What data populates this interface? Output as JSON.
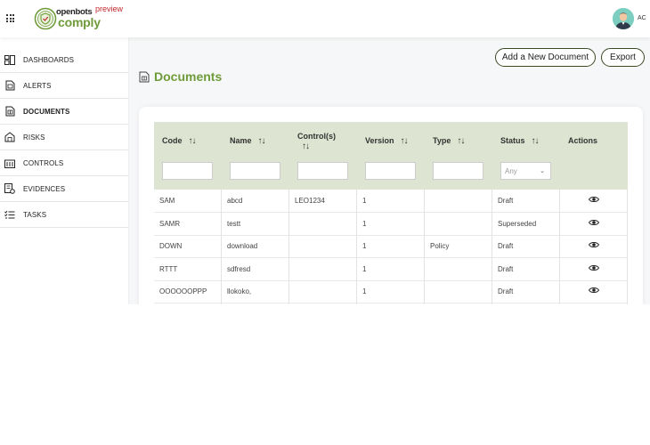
{
  "header": {
    "brand_top": "openbots",
    "brand_bottom": "comply",
    "preview_label": "preview",
    "user_initials": "AC"
  },
  "sidebar": {
    "items": [
      {
        "label": "DASHBOARDS",
        "icon": "dashboard-icon"
      },
      {
        "label": "ALERTS",
        "icon": "alert-icon"
      },
      {
        "label": "DOCUMENTS",
        "icon": "documents-icon",
        "active": true
      },
      {
        "label": "RISKS",
        "icon": "risks-icon"
      },
      {
        "label": "CONTROLS",
        "icon": "controls-icon"
      },
      {
        "label": "EVIDENCES",
        "icon": "evidences-icon"
      },
      {
        "label": "TASKS",
        "icon": "tasks-icon"
      }
    ]
  },
  "toolbar": {
    "add_label": "Add a New Document",
    "export_label": "Export"
  },
  "page": {
    "title": "Documents"
  },
  "table": {
    "columns": [
      {
        "label": "Code",
        "sort_icon": "↑↓"
      },
      {
        "label": "Name",
        "sort_icon": "↑↓"
      },
      {
        "label": "Control(s)",
        "sort_icon": "↑↓"
      },
      {
        "label": "Version",
        "sort_icon": "↑↓"
      },
      {
        "label": "Type",
        "sort_icon": "↑↓"
      },
      {
        "label": "Status",
        "sort_icon": "↑↓"
      },
      {
        "label": "Actions"
      }
    ],
    "status_filter_value": "Any",
    "rows": [
      {
        "code": "SAM",
        "name": "abcd",
        "controls": "LEO1234",
        "version": "1",
        "type": "",
        "status": "Draft"
      },
      {
        "code": "SAMR",
        "name": "testt",
        "controls": "",
        "version": "1",
        "type": "",
        "status": "Superseded"
      },
      {
        "code": "DOWN",
        "name": "download",
        "controls": "",
        "version": "1",
        "type": "Policy",
        "status": "Draft"
      },
      {
        "code": "RTTT",
        "name": "sdfresd",
        "controls": "",
        "version": "1",
        "type": "",
        "status": "Draft"
      },
      {
        "code": "OOOOOOPPP",
        "name": "llokoko,",
        "controls": "",
        "version": "1",
        "type": "",
        "status": "Draft"
      }
    ]
  },
  "colors": {
    "brand_green": "#6f9b3a",
    "header_row_bg": "#dde4d1",
    "button_border": "#3a4a23",
    "preview_red": "#c0282d"
  }
}
